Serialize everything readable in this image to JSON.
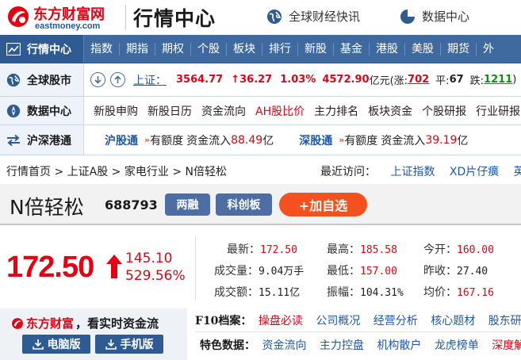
{
  "header": {
    "logo_cn": "东方财富网",
    "logo_en": "eastmoney.com",
    "title": "行情中心",
    "links": [
      {
        "label": "全球财经快讯",
        "icon": "globe-icon"
      },
      {
        "label": "数据中心",
        "icon": "pie-chart-icon"
      }
    ]
  },
  "nav": {
    "label": "行情中心",
    "items": [
      "指数",
      "期指",
      "期权",
      "个股",
      "板块",
      "排行",
      "新股",
      "基金",
      "港股",
      "美股",
      "期货",
      "外"
    ]
  },
  "global": {
    "label": "全球股市",
    "index_name": "上证：",
    "price": "3564.77",
    "change": "↑36.27",
    "change_pct": "1.03%",
    "turnover": "4572.90",
    "turnover_unit": "亿元",
    "up_label": "(涨:",
    "up_count": "702",
    "flat_label": "平:",
    "flat_count": "67",
    "down_label": "跌:",
    "down_count": "1211",
    "trail": ")"
  },
  "datacenter": {
    "label": "数据中心",
    "items": [
      {
        "label": "新股申购",
        "highlight": false
      },
      {
        "label": "新股日历",
        "highlight": false
      },
      {
        "label": "资金流向",
        "highlight": false
      },
      {
        "label": "AH股比价",
        "highlight": true
      },
      {
        "label": "主力排名",
        "highlight": false
      },
      {
        "label": "板块资金",
        "highlight": false
      },
      {
        "label": "个股研报",
        "highlight": false
      },
      {
        "label": "行业研报",
        "highlight": false
      }
    ]
  },
  "connect": {
    "label": "沪深港通",
    "sh": {
      "name": "沪股通",
      "quota": "有额度",
      "flow_label": "资金流入",
      "flow_value": "88.49",
      "unit": "亿"
    },
    "sz": {
      "name": "深股通",
      "quota": "有额度",
      "flow_label": "资金流入",
      "flow_value": "39.19",
      "unit": "亿"
    }
  },
  "breadcrumb": {
    "items": [
      "行情首页",
      "上证A股",
      "家电行业",
      "N倍轻松"
    ],
    "recent_label": "最近访问：",
    "recent": [
      "上证指数",
      "XD片仔癀",
      "英科"
    ]
  },
  "stock": {
    "name": "N倍轻松",
    "code": "688793",
    "tags": [
      "两融",
      "科创板"
    ],
    "add_label": "+加自选"
  },
  "quote": {
    "price": "172.50",
    "change": "145.10",
    "change_pct": "529.56%",
    "fields": [
      {
        "label": "最新：",
        "value": "172.50",
        "color": "red"
      },
      {
        "label": "最高：",
        "value": "185.58",
        "color": "red"
      },
      {
        "label": "今开：",
        "value": "160.00",
        "color": "red"
      },
      {
        "label": "成交量：",
        "value": "9.04万手",
        "color": "black"
      },
      {
        "label": "最低：",
        "value": "157.00",
        "color": "red"
      },
      {
        "label": "昨收：",
        "value": "27.40",
        "color": "black"
      },
      {
        "label": "成交额：",
        "value": "15.11亿",
        "color": "black"
      },
      {
        "label": "振幅：",
        "value": "104.31%",
        "color": "black"
      },
      {
        "label": "均价：",
        "value": "167.16",
        "color": "red"
      }
    ]
  },
  "promo": {
    "brand": "东方财富",
    "slogan": "，看实时资金流",
    "pc_label": "电脑版",
    "mobile_label": "手机版"
  },
  "f10": {
    "label": "F10档案：",
    "items": [
      {
        "label": "操盘必读",
        "highlight": true
      },
      {
        "label": "公司概况",
        "highlight": false
      },
      {
        "label": "经营分析",
        "highlight": false
      },
      {
        "label": "核心题材",
        "highlight": false
      },
      {
        "label": "股东研",
        "highlight": false
      }
    ]
  },
  "features": {
    "label": "特色数据：",
    "items": [
      {
        "label": "资金流向",
        "highlight": false
      },
      {
        "label": "主力控盘",
        "highlight": false
      },
      {
        "label": "机构散户",
        "highlight": false
      },
      {
        "label": "龙虎榜单",
        "highlight": false
      },
      {
        "label": "深度解",
        "highlight": true
      }
    ]
  },
  "colors": {
    "up_red": "#e60012",
    "down_green": "#009900",
    "link_blue": "#1e58a8",
    "nav_blue": "#3f6aa0",
    "add_orange": "#f4511e"
  }
}
